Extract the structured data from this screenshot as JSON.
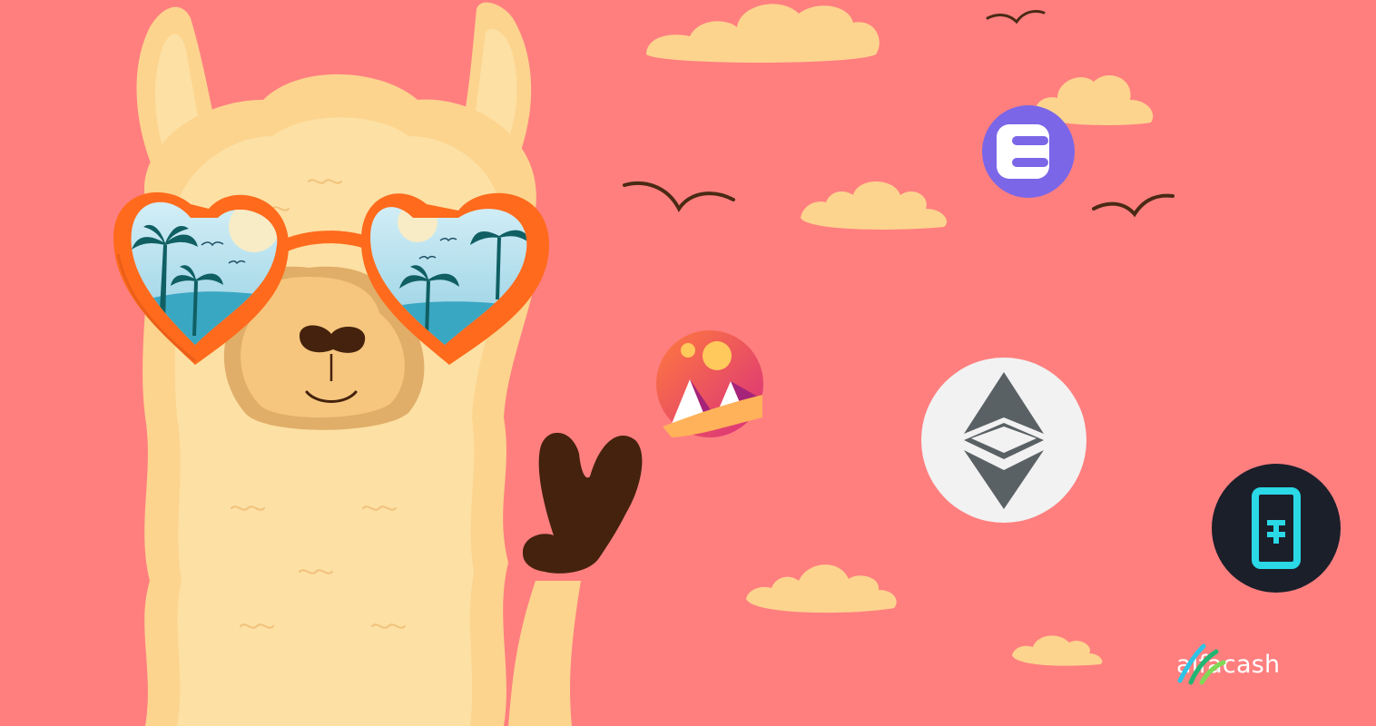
{
  "banner": {
    "brand_name": "alfacash",
    "background_color": "#ff7f7f",
    "mascot": "llama-with-heart-sunglasses",
    "coins": [
      {
        "icon": "enjin-coin-icon",
        "color": "#7b66e8"
      },
      {
        "icon": "decentraland-coin-icon",
        "color": "#ff5c5c"
      },
      {
        "icon": "ethereum-classic-coin-icon",
        "color": "#f2f2f2"
      },
      {
        "icon": "theta-fuel-coin-icon",
        "color": "#1b1f2a"
      }
    ],
    "logo_colors": [
      "#2ec4e6",
      "#7ed957",
      "#21b573"
    ]
  }
}
